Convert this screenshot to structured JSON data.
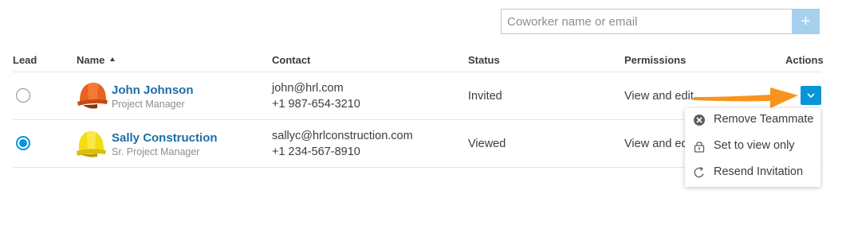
{
  "invite": {
    "placeholder": "Coworker name or email",
    "add_label": "+"
  },
  "table": {
    "headers": {
      "lead": "Lead",
      "name": "Name",
      "contact": "Contact",
      "status": "Status",
      "permissions": "Permissions",
      "actions": "Actions"
    },
    "sort": {
      "column": "name",
      "direction": "ascending"
    },
    "rows": [
      {
        "lead_selected": false,
        "avatar": "orange-hardhat-icon",
        "name": "John Johnson",
        "title": "Project Manager",
        "email": "john@hrl.com",
        "phone": "+1 987-654-3210",
        "status": "Invited",
        "permissions": "View and edit"
      },
      {
        "lead_selected": true,
        "avatar": "yellow-hardhat-icon",
        "name": "Sally Construction",
        "title": "Sr. Project Manager",
        "email": "sallyc@hrlconstruction.com",
        "phone": "+1 234-567-8910",
        "status": "Viewed",
        "permissions": "View and edit"
      }
    ]
  },
  "actions_menu": {
    "items": [
      {
        "label": "Remove Teammate",
        "icon": "x-circle-icon"
      },
      {
        "label": "Set to view only",
        "icon": "lock-icon"
      },
      {
        "label": "Resend Invitation",
        "icon": "refresh-icon"
      }
    ]
  },
  "colors": {
    "accent": "#0696d7",
    "name_link": "#1c6ea4",
    "add_button": "#a6d1ee",
    "callout_arrow": "#f7941e"
  }
}
